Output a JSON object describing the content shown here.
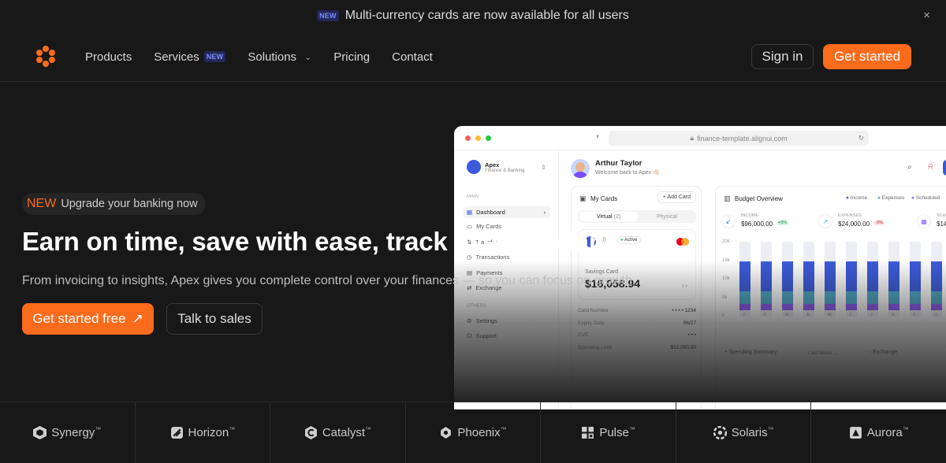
{
  "announcement": {
    "badge": "NEW",
    "text": "Multi-currency cards are now available for all users",
    "close": "×"
  },
  "nav": {
    "links": [
      "Products",
      "Services",
      "Solutions",
      "Pricing",
      "Contact"
    ],
    "services_badge": "NEW",
    "sign_in": "Sign in",
    "get_started": "Get started"
  },
  "hero": {
    "pill_tag": "NEW",
    "pill_text": "Upgrade your banking now",
    "headline": "Earn on time, save with ease, track every dollar.",
    "subline": "From invoicing to insights, Apex gives you complete control over your finances — so you can focus on growth.",
    "cta_primary": "Get started free",
    "cta_primary_icon": "↗",
    "cta_secondary": "Talk to sales"
  },
  "mock": {
    "url": "finance-template.alignui.com",
    "brand": "Apex",
    "brand_sub": "Finance & Banking",
    "section_main": "MAIN",
    "nav": [
      "Dashboard",
      "My Cards",
      "Transfer",
      "Transactions",
      "Payments",
      "Exchange"
    ],
    "section_others": "OTHERS",
    "others": [
      "Settings",
      "Support"
    ],
    "user_name": "Arthur Taylor",
    "user_greeting": "Welcome back to Apex 👋🏻",
    "cards_title": "My Cards",
    "add_card": "+ Add Card",
    "tab_virtual": "Virtual",
    "tab_virtual_count": "(2)",
    "tab_physical": "Physical",
    "card_status": "Active",
    "card_label": "Savings Card",
    "card_balance": "$16,058.94",
    "card_number_label": "Card Number",
    "card_number": "• • • • 1234",
    "expiry_label": "Expiry Date",
    "expiry": "06/27",
    "cvc_label": "CVC",
    "cvc": "• • •",
    "spending_label": "Spending Limit",
    "spending": "$12,000.00",
    "budget_title": "Budget Overview",
    "legend": [
      "Income",
      "Expenses",
      "Scheduled"
    ],
    "income_label": "INCOME",
    "income_value": "$96,000.00",
    "income_change": "+5%",
    "expenses_label": "EXPENSES",
    "expenses_value": "$24,000.00",
    "expenses_change": "-3%",
    "scheduled_label": "SCH",
    "scheduled_value": "$14",
    "y_ticks": [
      "20k",
      "15k",
      "10k",
      "5k",
      "0"
    ],
    "months": [
      "J",
      "F",
      "M",
      "A",
      "M",
      "J",
      "J",
      "A",
      "S",
      "O",
      "N",
      "D"
    ],
    "spending_summary": "Spending Summary",
    "last_week": "Last Week",
    "exchange": "Exchange"
  },
  "logos": [
    {
      "name": "Synergy",
      "tm": "™"
    },
    {
      "name": "Horizon",
      "tm": "™"
    },
    {
      "name": "Catalyst",
      "tm": "™"
    },
    {
      "name": "Phoenix",
      "tm": "™"
    },
    {
      "name": "Pulse",
      "tm": "™"
    },
    {
      "name": "Solaris",
      "tm": "™"
    },
    {
      "name": "Aurora",
      "tm": "™"
    }
  ],
  "colors": {
    "accent": "#fb6b1c",
    "background": "#181818",
    "income_bar": "#3b5bdb",
    "expenses_bar": "#4ea8c7",
    "scheduled_bar": "#8b5cf6"
  }
}
